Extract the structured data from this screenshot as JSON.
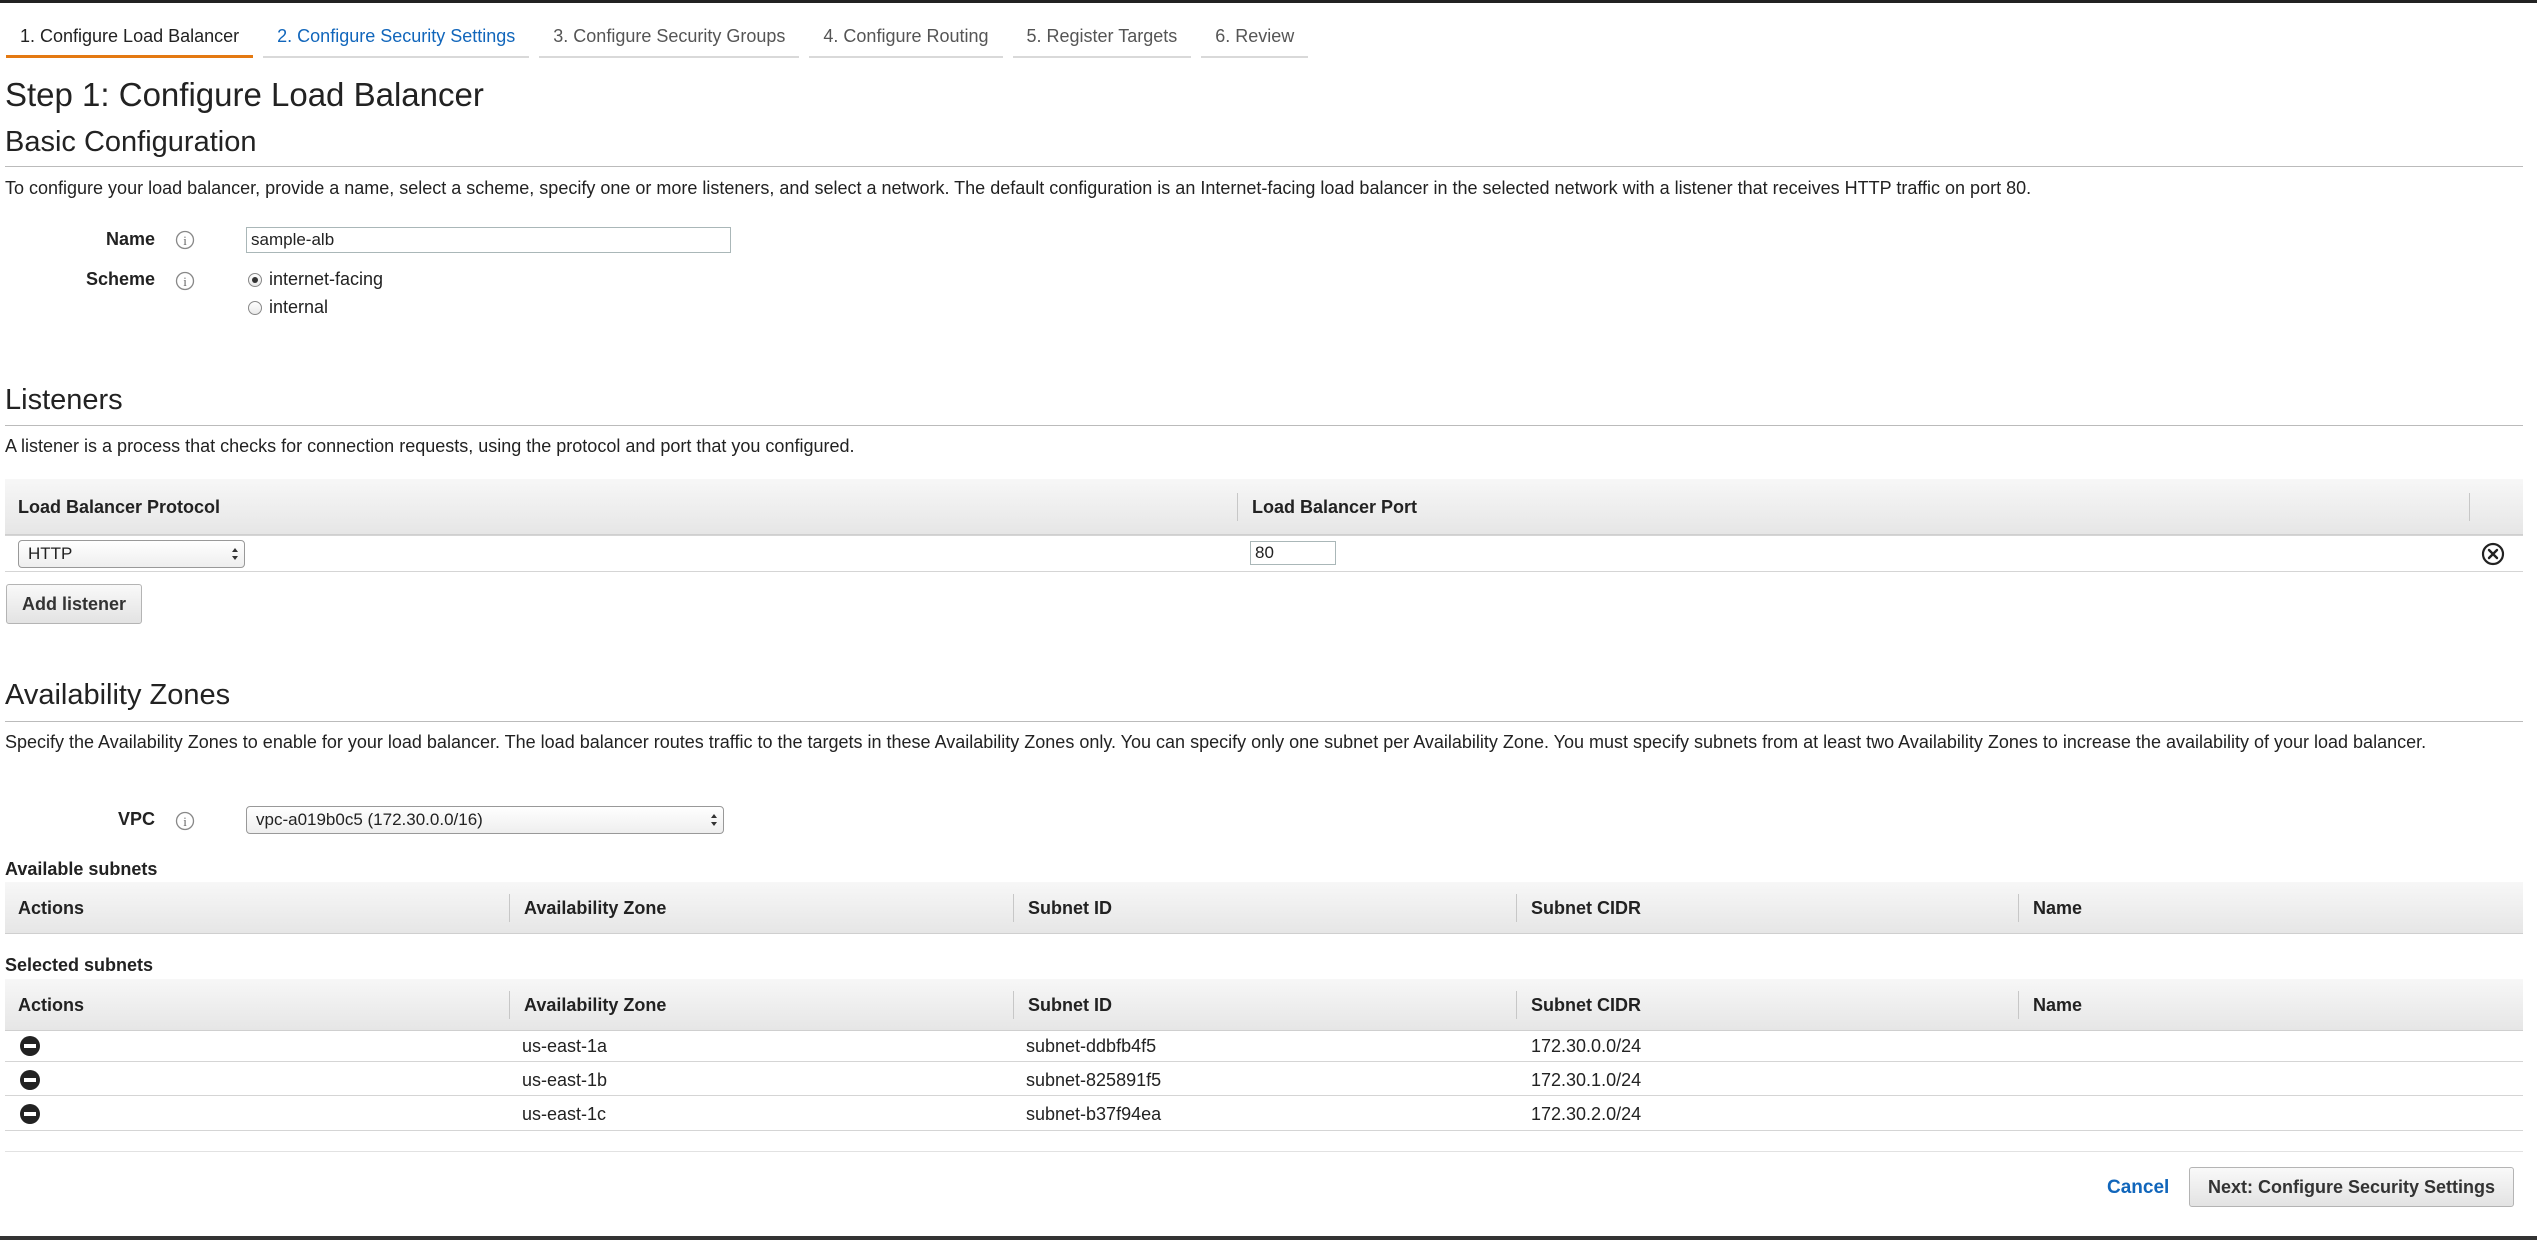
{
  "wizard": {
    "tabs": [
      {
        "label": "1. Configure Load Balancer"
      },
      {
        "label": "2. Configure Security Settings"
      },
      {
        "label": "3. Configure Security Groups"
      },
      {
        "label": "4. Configure Routing"
      },
      {
        "label": "5. Register Targets"
      },
      {
        "label": "6. Review"
      }
    ],
    "active_color": "#e47911",
    "link_color": "#1166bb"
  },
  "page": {
    "title": "Step 1: Configure Load Balancer"
  },
  "basic": {
    "title": "Basic Configuration",
    "description": "To configure your load balancer, provide a name, select a scheme, specify one or more listeners, and select a network. The default configuration is an Internet-facing load balancer in the selected network with a listener that receives HTTP traffic on port 80.",
    "name_label": "Name",
    "name_value": "sample-alb",
    "scheme_label": "Scheme",
    "scheme_options": [
      {
        "label": "internet-facing",
        "selected": true
      },
      {
        "label": "internal",
        "selected": false
      }
    ],
    "info_icon": "info-icon"
  },
  "listeners": {
    "title": "Listeners",
    "description": "A listener is a process that checks for connection requests, using the protocol and port that you configured.",
    "col_protocol": "Load Balancer Protocol",
    "col_port": "Load Balancer Port",
    "rows": [
      {
        "protocol": "HTTP",
        "port": "80"
      }
    ],
    "add_button": "Add listener",
    "remove_icon": "close-circle-icon"
  },
  "az": {
    "title": "Availability Zones",
    "description": "Specify the Availability Zones to enable for your load balancer. The load balancer routes traffic to the targets in these Availability Zones only. You can specify only one subnet per Availability Zone. You must specify subnets from at least two Availability Zones to increase the availability of your load balancer.",
    "vpc_label": "VPC",
    "vpc_value": "vpc-a019b0c5 (172.30.0.0/16)",
    "available_title": "Available subnets",
    "selected_title": "Selected subnets",
    "columns": [
      "Actions",
      "Availability Zone",
      "Subnet ID",
      "Subnet CIDR",
      "Name"
    ],
    "selected_rows": [
      {
        "zone": "us-east-1a",
        "subnet_id": "subnet-ddbfb4f5",
        "cidr": "172.30.0.0/24",
        "name": ""
      },
      {
        "zone": "us-east-1b",
        "subnet_id": "subnet-825891f5",
        "cidr": "172.30.1.0/24",
        "name": ""
      },
      {
        "zone": "us-east-1c",
        "subnet_id": "subnet-b37f94ea",
        "cidr": "172.30.2.0/24",
        "name": ""
      }
    ],
    "row_action_icon": "remove-circle-icon"
  },
  "footer": {
    "cancel": "Cancel",
    "next": "Next: Configure Security Settings"
  }
}
